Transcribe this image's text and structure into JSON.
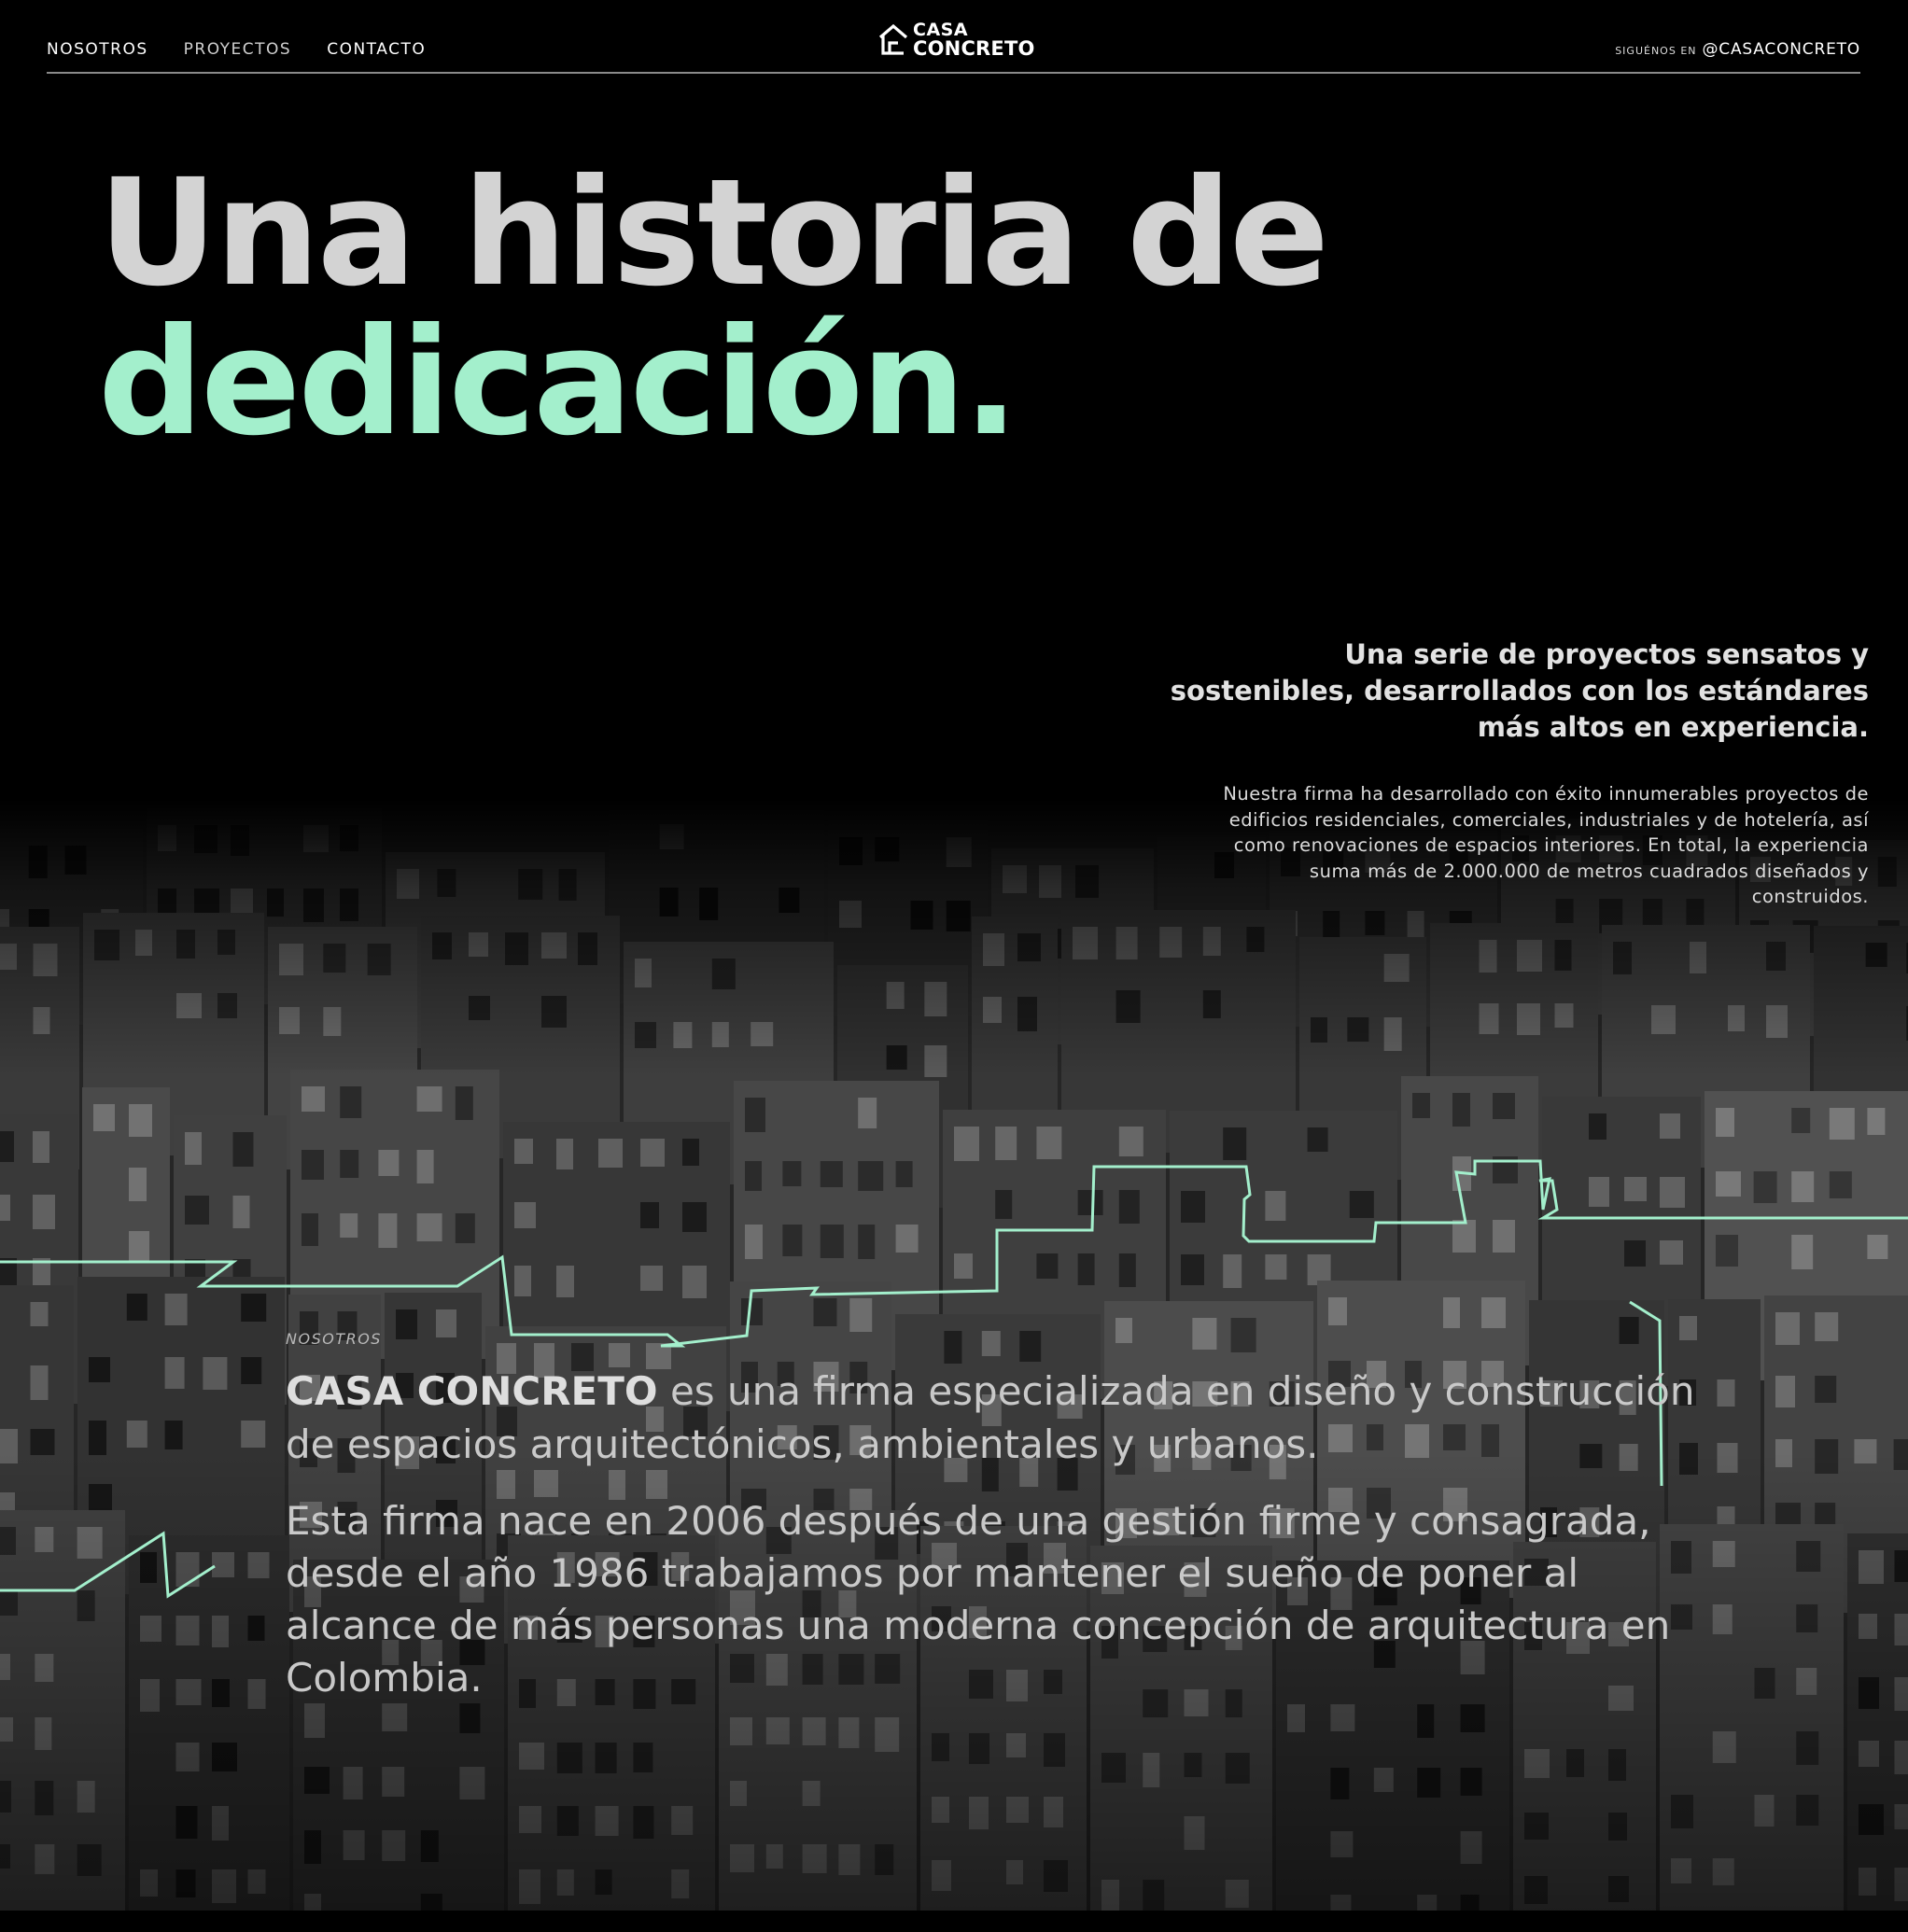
{
  "nav": {
    "items": [
      {
        "label": "NOSOTROS"
      },
      {
        "label": "PROYECTOS"
      },
      {
        "label": "CONTACTO"
      }
    ]
  },
  "logo": {
    "line1": "CASA",
    "line2": "CONCRETO",
    "icon": "house-icon"
  },
  "social": {
    "label": "SIGUÉNOS EN",
    "handle": "@CASACONCRETO"
  },
  "hero": {
    "line1": "Una historia de",
    "line2": "dedicación."
  },
  "intro": {
    "lead": "Una serie de proyectos sensatos y sostenibles, desarrollados con los estándares más altos en experiencia.",
    "body": "Nuestra firma ha desarrollado con éxito innumerables proyectos de edificios residenciales, comerciales, industriales y de hotelería, así como renovaciones de espacios interiores. En total, la experiencia suma más de 2.000.000 de metros cuadrados diseñados y construidos."
  },
  "about": {
    "kicker": "NOSOTROS",
    "brand": "CASA CONCRETO",
    "p1_rest": " es una firma especializada en diseño y construcción de espacios arquitectónicos, ambientales y urbanos.",
    "p2": "Esta firma nace en 2006 después de una gestión firme y consagrada, desde el año 1986 trabajamos por mantener el sueño de poner al alcance de más personas una moderna concepción de arquitectura en Colombia."
  },
  "colors": {
    "accent": "#a3efcc",
    "background": "#000000",
    "headline_gray": "#d3d3d3"
  }
}
